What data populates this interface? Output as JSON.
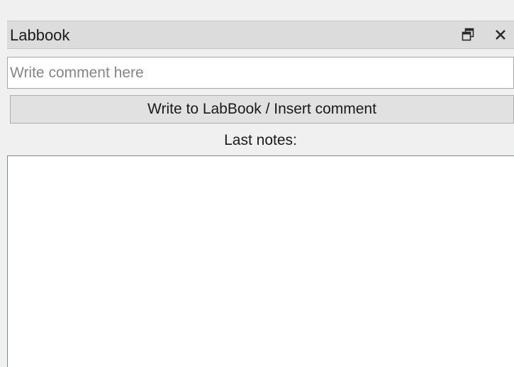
{
  "panel": {
    "title": "Labbook",
    "float_icon": "restore-window-icon",
    "close_icon": "close-icon"
  },
  "comment": {
    "placeholder": "Write comment here",
    "value": ""
  },
  "write_button": {
    "label": "Write to LabBook / Insert comment"
  },
  "notes": {
    "label": "Last notes:",
    "items": []
  },
  "colors": {
    "window_bg": "#f0f0f0",
    "titlebar_bg": "#dcdcdc",
    "button_bg": "#e1e1e1",
    "field_border": "#a6a6a6"
  }
}
